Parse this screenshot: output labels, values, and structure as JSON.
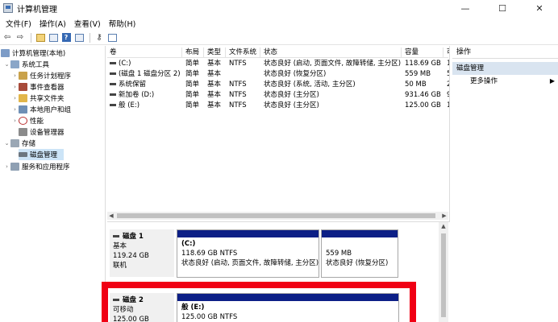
{
  "window": {
    "title": "计算机管理",
    "minimize": "—",
    "maximize": "☐",
    "close": "✕"
  },
  "menu": [
    "文件(F)",
    "操作(A)",
    "查看(V)",
    "帮助(H)"
  ],
  "tree": {
    "root": "计算机管理(本地)",
    "system_tools": "系统工具",
    "task_scheduler": "任务计划程序",
    "event_viewer": "事件查看器",
    "shared_folders": "共享文件夹",
    "local_users": "本地用户和组",
    "performance": "性能",
    "device_manager": "设备管理器",
    "storage": "存储",
    "disk_management": "磁盘管理",
    "services": "服务和应用程序"
  },
  "volumes": {
    "headers": [
      "卷",
      "布局",
      "类型",
      "文件系统",
      "状态",
      "容量",
      "可"
    ],
    "rows": [
      [
        "(C:)",
        "简单",
        "基本",
        "NTFS",
        "状态良好 (启动, 页面文件, 故障转储, 主分区)",
        "118.69 GB",
        "1"
      ],
      [
        "(磁盘 1 磁盘分区 2)",
        "简单",
        "基本",
        "",
        "状态良好 (恢复分区)",
        "559 MB",
        "5"
      ],
      [
        "系统保留",
        "简单",
        "基本",
        "NTFS",
        "状态良好 (系统, 活动, 主分区)",
        "50 MB",
        "2"
      ],
      [
        "新加卷 (D:)",
        "简单",
        "基本",
        "NTFS",
        "状态良好 (主分区)",
        "931.46 GB",
        "9"
      ],
      [
        "般 (E:)",
        "简单",
        "基本",
        "NTFS",
        "状态良好 (主分区)",
        "125.00 GB",
        "1"
      ]
    ]
  },
  "disks": [
    {
      "name": "磁盘 1",
      "type": "基本",
      "size": "119.24 GB",
      "status": "联机",
      "partitions": [
        {
          "label": "(C:)",
          "size": "118.69 GB NTFS",
          "status": "状态良好 (启动, 页面文件, 故障转储, 主分区)"
        },
        {
          "label": "",
          "size": "559 MB",
          "status": "状态良好 (恢复分区)"
        }
      ]
    },
    {
      "name": "磁盘 2",
      "type": "可移动",
      "size": "125.00 GB",
      "partitions": [
        {
          "label": "般 (E:)",
          "size": "125.00 GB NTFS"
        }
      ]
    }
  ],
  "actions": {
    "header": "操作",
    "section": "磁盘管理",
    "more": "更多操作"
  },
  "colors": {
    "partition_bar": "#0c1f86",
    "highlight_box": "#f00014",
    "selected_row": "#cce4f7"
  }
}
